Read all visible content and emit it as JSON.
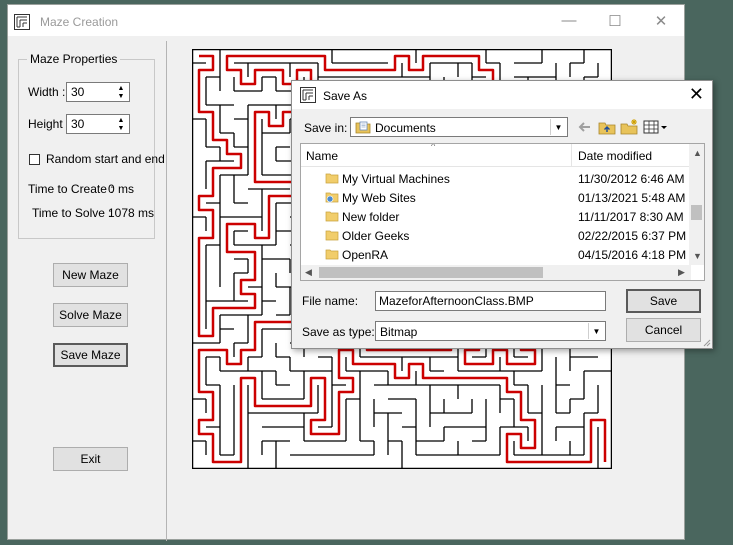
{
  "window": {
    "title": "Maze Creation",
    "controls": {
      "minimize": "—",
      "maximize": "☐",
      "close": "✕"
    }
  },
  "properties": {
    "group_title": "Maze Properties",
    "width_label": "Width :",
    "width_value": "30",
    "height_label": "Height :",
    "height_value": "30",
    "random_label": "Random start and end",
    "random_checked": false,
    "time_create_label": "Time to Create :",
    "time_create_value": "0 ms",
    "time_solve_label": "Time to Solve :",
    "time_solve_value": "1078 ms"
  },
  "buttons": {
    "new_maze": "New Maze",
    "solve_maze": "Solve Maze",
    "save_maze": "Save Maze",
    "exit": "Exit"
  },
  "maze": {
    "wall_color": "#000000",
    "path_color": "#cc0000",
    "grid_size": 30
  },
  "dialog": {
    "title": "Save As",
    "close": "✕",
    "save_in_label": "Save in:",
    "save_in_value": "Documents",
    "columns": {
      "name": "Name",
      "date": "Date modified"
    },
    "files": [
      {
        "name": "My Virtual Machines",
        "date": "11/30/2012 6:46 AM",
        "icon": "folder-icon"
      },
      {
        "name": "My Web Sites",
        "date": "01/13/2021 5:48 AM",
        "icon": "web-folder-icon"
      },
      {
        "name": "New folder",
        "date": "11/11/2017 8:30 AM",
        "icon": "folder-icon"
      },
      {
        "name": "Older Geeks",
        "date": "02/22/2015 6:37 PM",
        "icon": "folder-icon"
      },
      {
        "name": "OpenRA",
        "date": "04/15/2016 4:18 PM",
        "icon": "folder-icon"
      }
    ],
    "file_name_label": "File name:",
    "file_name_value": "MazeforAfternoonClass.BMP",
    "save_type_label": "Save as type:",
    "save_type_value": "Bitmap",
    "save_button": "Save",
    "cancel_button": "Cancel"
  }
}
